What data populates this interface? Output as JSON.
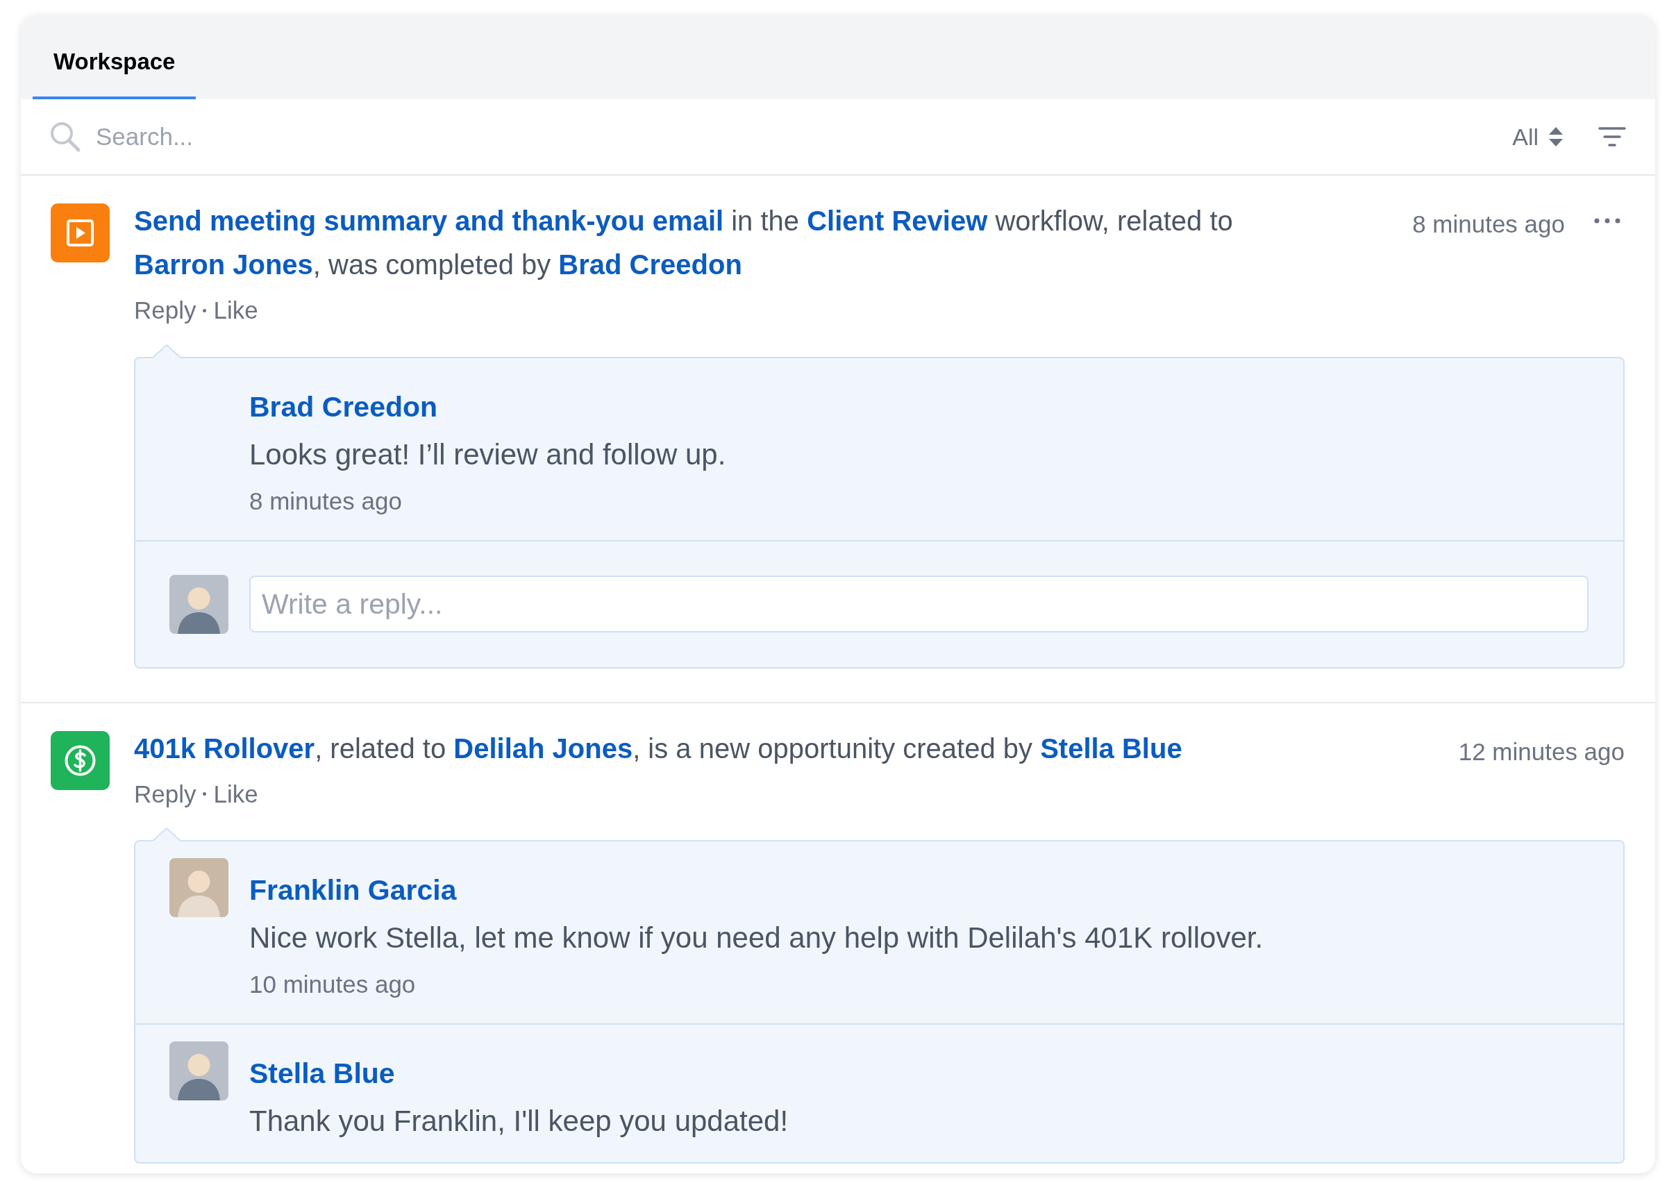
{
  "tabs": [
    {
      "label": "Workspace",
      "selected": true
    }
  ],
  "search": {
    "placeholder": "Search..."
  },
  "filter": {
    "value": "All"
  },
  "activities": [
    {
      "kind": "workflow",
      "menu": true,
      "time": "8 minutes ago",
      "summary": [
        {
          "kind": "link",
          "text": "Send meeting summary and thank-you email"
        },
        {
          "kind": "text",
          "text": " in the "
        },
        {
          "kind": "link",
          "text": "Client Review"
        },
        {
          "kind": "text",
          "text": " workflow, related to "
        },
        {
          "kind": "link",
          "text": "Barron Jones"
        },
        {
          "kind": "text",
          "text": ", was completed by "
        },
        {
          "kind": "link",
          "text": "Brad Creedon"
        }
      ],
      "actions": [
        "Reply",
        "Like"
      ],
      "comments": [
        {
          "author": "Brad Creedon",
          "avatar": false,
          "text": "Looks great! I’ll review and follow up.",
          "time": "8 minutes ago"
        }
      ],
      "reply_field": {
        "placeholder": "Write a reply..."
      }
    },
    {
      "kind": "opportunity",
      "menu": false,
      "time": "12 minutes ago",
      "summary": [
        {
          "kind": "link",
          "text": "401k Rollover"
        },
        {
          "kind": "text",
          "text": ", related to "
        },
        {
          "kind": "link",
          "text": "Delilah Jones"
        },
        {
          "kind": "text",
          "text": ", is a new opportunity created by "
        },
        {
          "kind": "link",
          "text": "Stella Blue"
        }
      ],
      "actions": [
        "Reply",
        "Like"
      ],
      "comments": [
        {
          "author": "Franklin Garcia",
          "avatar": true,
          "text": "Nice work Stella, let me know if you need any help with Delilah's 401K rollover.",
          "time": "10 minutes ago"
        },
        {
          "author": "Stella Blue",
          "avatar": true,
          "text": "Thank you Franklin, I'll keep you updated!"
        }
      ]
    }
  ]
}
